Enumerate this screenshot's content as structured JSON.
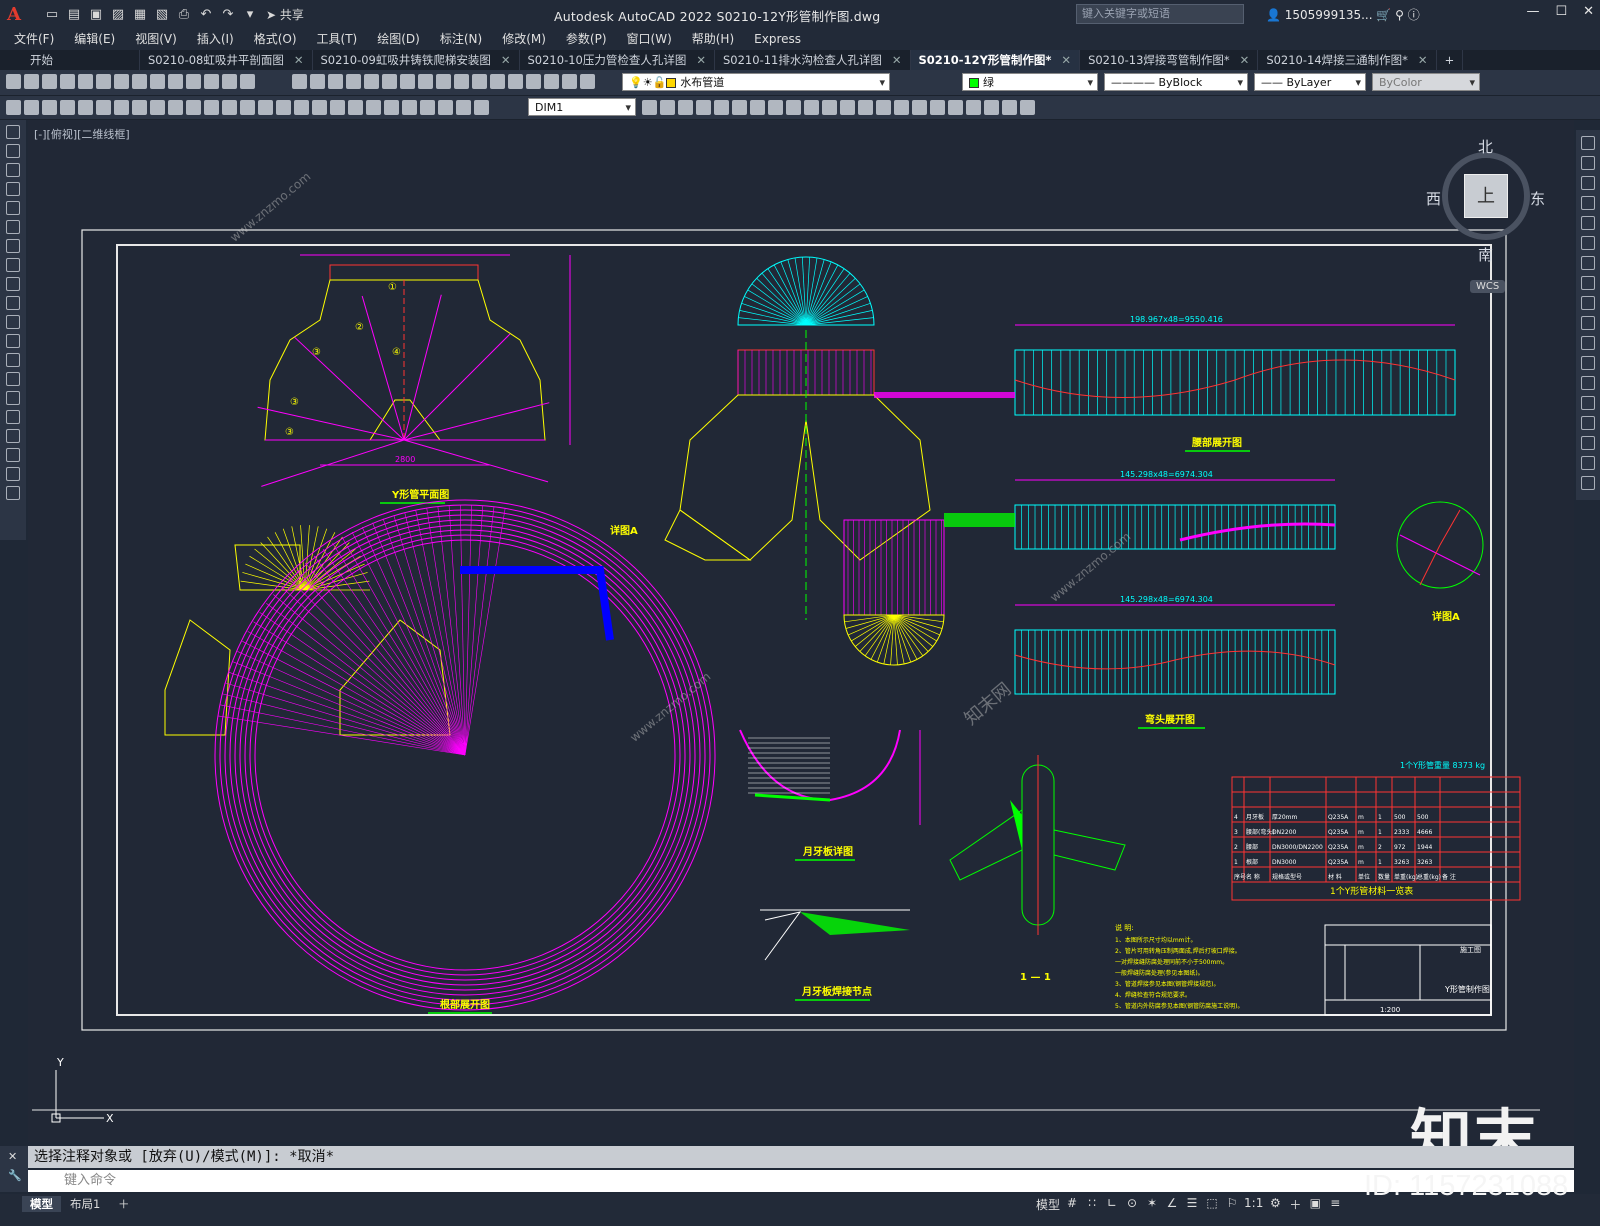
{
  "title_bar": {
    "app_title": "Autodesk AutoCAD 2022    S0210-12Y形管制作图.dwg",
    "share_label": "共享",
    "search_placeholder": "键入关键字或短语",
    "user": "1505999135...",
    "logo_letter": "A"
  },
  "menu": [
    "文件(F)",
    "编辑(E)",
    "视图(V)",
    "插入(I)",
    "格式(O)",
    "工具(T)",
    "绘图(D)",
    "标注(N)",
    "修改(M)",
    "参数(P)",
    "窗口(W)",
    "帮助(H)",
    "Express"
  ],
  "tabs": [
    {
      "label": "开始",
      "active": false,
      "closable": false
    },
    {
      "label": "S0210-08虹吸井平剖面图",
      "active": false,
      "closable": true
    },
    {
      "label": "S0210-09虹吸井铸铁爬梯安装图",
      "active": false,
      "closable": true
    },
    {
      "label": "S0210-10压力管检查人孔详图",
      "active": false,
      "closable": true
    },
    {
      "label": "S0210-11排水沟检查人孔详图",
      "active": false,
      "closable": true
    },
    {
      "label": "S0210-12Y形管制作图*",
      "active": true,
      "closable": true
    },
    {
      "label": "S0210-13焊接弯管制作图*",
      "active": false,
      "closable": true
    },
    {
      "label": "S0210-14焊接三通制作图*",
      "active": false,
      "closable": true
    }
  ],
  "properties": {
    "layer": "水布管道",
    "color": "绿",
    "linetype": "ByBlock",
    "lineweight": "ByLayer",
    "plotstyle": "ByColor",
    "dimstyle": "DIM1"
  },
  "viewport": {
    "label": "[-][俯视][二维线框]",
    "viewcube": {
      "north": "北",
      "south": "南",
      "east": "东",
      "west": "西",
      "face": "上",
      "wcs": "WCS"
    }
  },
  "drawing": {
    "titles": {
      "plan": "Y形管平面图",
      "waist": "腰部展开图",
      "detail_a_ref": "详图A",
      "detail_a": "详图A",
      "root": "根部展开图",
      "elbow": "弯头展开图",
      "crescent": "月牙板详图",
      "crescent_weld": "月牙板焊接节点",
      "section": "1 — 1",
      "materials": "1个Y形管材料一览表",
      "drawing_name": "Y形管制作图"
    },
    "dims": {
      "waist_len": "198.967x48=9550.416",
      "elbow_len1": "145.298x48=6974.304",
      "elbow_len2": "145.298x48=6974.304",
      "plan_width": "2800"
    },
    "materials_total": "1个Y形管重量 8373 kg",
    "materials_rows": [
      [
        "4",
        "月牙板",
        "厚20mm",
        "Q235A",
        "m",
        "1",
        "500",
        "500"
      ],
      [
        "3",
        "腰部(弯头)",
        "DN2200",
        "Q235A",
        "m",
        "1",
        "2333",
        "4666"
      ],
      [
        "2",
        "腰部",
        "DN3000/DN2200",
        "Q235A",
        "m",
        "2",
        "972",
        "1944"
      ],
      [
        "1",
        "根部",
        "DN3000",
        "Q235A",
        "m",
        "1",
        "3263",
        "3263"
      ]
    ],
    "materials_header": [
      "序号",
      "名 称",
      "规格或型号",
      "材 料",
      "单位",
      "数量",
      "单重(kg)",
      "总重(kg)",
      "备 注"
    ],
    "notes_title": "说 明:",
    "notes": [
      "1、本图所示尺寸均以mm计。",
      "2、管片可用转角压制两面成,焊后打坡口焊接。",
      "   一对焊接缝防腐处理同前不小于500mm。",
      "   一般焊缝防腐处理(参见本图纸)。",
      "3、管道焊接参见本图(钢管焊接规范)。",
      "4、焊缝检查符合规范要求。",
      "5、管道内外防腐参见本图(钢管防腐施工说明)。"
    ],
    "titleblock": {
      "stage": "施工图",
      "scale": "1:200"
    }
  },
  "command": {
    "history": "选择注释对象或 [放弃(U)/模式(M)]: *取消*",
    "placeholder": "键入命令"
  },
  "status": {
    "layout_tabs": [
      "模型",
      "布局1"
    ],
    "model_btn": "模型",
    "scale": "1:1"
  },
  "branding": {
    "logo": "知末",
    "id": "ID: 1157231088",
    "watermark_site": "www.znzmo.com",
    "watermark_brand": "知末网"
  }
}
